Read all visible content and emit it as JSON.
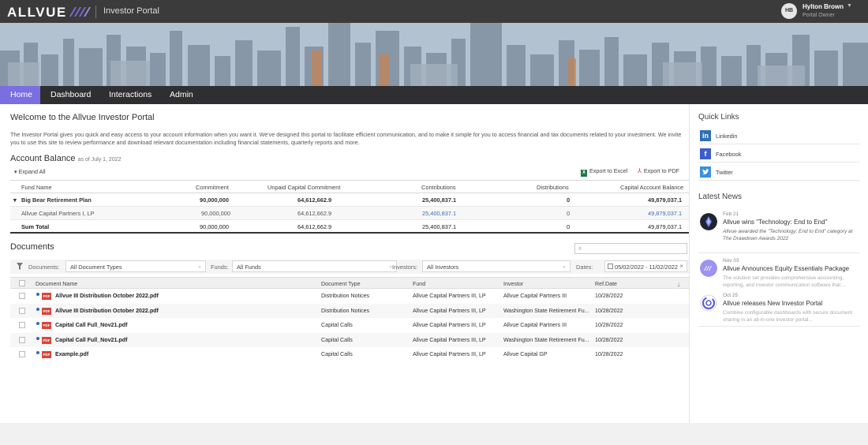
{
  "header": {
    "logo_text": "ALLVUE",
    "portal_title": "Investor Portal",
    "user": {
      "initials": "HB",
      "name": "Hylton Brown",
      "role": "Portal Owner"
    }
  },
  "nav": {
    "items": [
      {
        "label": "Home",
        "active": true
      },
      {
        "label": "Dashboard",
        "active": false
      },
      {
        "label": "Interactions",
        "active": false
      },
      {
        "label": "Admin",
        "active": false
      }
    ]
  },
  "welcome": {
    "title": "Welcome to the Allvue Investor Portal",
    "intro": "The Investor Portal gives you quick and easy access to your account information when you want it. We've designed this portal to facilitate efficient communication, and to make it simple for you to access financial and tax documents related to your investment. We invite you to use this site to review performance and download relevant documentation including financial statements, quarterly reports and more."
  },
  "account_balance": {
    "title": "Account Balance",
    "as_of": "as of July 1, 2022",
    "expand_all": "Expand All",
    "export_excel": "Export to Excel",
    "export_pdf": "Export to PDF",
    "columns": [
      "Fund Name",
      "Commitment",
      "Unpaid Capital Commitment",
      "Contributions",
      "Distributions",
      "Capital Account Balance"
    ],
    "rows": [
      {
        "fund": "Big Bear Retirement Plan",
        "commitment": "90,000,000",
        "unpaid": "64,612,662.9",
        "contributions": "25,400,837.1",
        "distributions": "0",
        "balance": "49,879,037.1"
      },
      {
        "fund": "Allvue Capital Partners I, LP",
        "commitment": "90,000,000",
        "unpaid": "64,612,662.9",
        "contributions": "25,400,837.1",
        "distributions": "0",
        "balance": "49,879,037.1"
      },
      {
        "fund": "Sum Total",
        "commitment": "90,000,000",
        "unpaid": "64,612,662.9",
        "contributions": "25,400,837.1",
        "distributions": "0",
        "balance": "49,879,037.1"
      }
    ]
  },
  "documents": {
    "title": "Documents",
    "filters": {
      "documents_label": "Documents:",
      "documents_value": "All Document Types",
      "funds_label": "Funds:",
      "funds_value": "All Funds",
      "investors_label": "Investors:",
      "investors_value": "All Investors",
      "dates_label": "Dates:",
      "dates_value": "05/02/2022 - 11/02/2022"
    },
    "columns": [
      "Document Name",
      "Document Type",
      "Fund",
      "Investor",
      "Ref.Date"
    ],
    "rows": [
      {
        "name": "Allvue III Distribution October 2022.pdf",
        "type": "Distribution Notices",
        "fund": "Allvue Capital Partners III, LP",
        "investor": "Allvue Capital Partners III",
        "date": "10/28/2022"
      },
      {
        "name": "Allvue III Distribution October 2022.pdf",
        "type": "Distribution Notices",
        "fund": "Allvue Capital Partners III, LP",
        "investor": "Washington State Retirement Fu...",
        "date": "10/28/2022"
      },
      {
        "name": "Capital Call Full_Nov21.pdf",
        "type": "Capital Calls",
        "fund": "Allvue Capital Partners III, LP",
        "investor": "Allvue Capital Partners III",
        "date": "10/28/2022"
      },
      {
        "name": "Capital Call Full_Nov21.pdf",
        "type": "Capital Calls",
        "fund": "Allvue Capital Partners III, LP",
        "investor": "Washington State Retirement Fu...",
        "date": "10/28/2022"
      },
      {
        "name": "Example.pdf",
        "type": "Capital Calls",
        "fund": "Allvue Capital Partners III, LP",
        "investor": "Allvue Capital GP",
        "date": "10/28/2022"
      }
    ]
  },
  "quick_links": {
    "title": "Quick Links",
    "items": [
      {
        "label": "Linkedin",
        "icon": "linkedin-icon",
        "glyph": "in",
        "color": "#2f6fb5"
      },
      {
        "label": "Facebook",
        "icon": "facebook-icon",
        "glyph": "f",
        "color": "#3b5ec9"
      },
      {
        "label": "Twitter",
        "icon": "twitter-icon",
        "glyph": "t",
        "color": "#3b8fe0"
      }
    ]
  },
  "news": {
    "title": "Latest News",
    "items": [
      {
        "date": "Feb 21",
        "title": "Allvue wins \"Technology: End to End\"",
        "body": "Allvue awarded the \"Technology: End to End\" category at The Drawdown Awards 2022"
      },
      {
        "date": "Nov 03",
        "title": "Allvue Announces Equity Essentials Package",
        "body": "The solution set provides comprehensive accounting, reporting, and investor communication software that ..."
      },
      {
        "date": "Oct 25",
        "title": "Allvue releases New Investor Portal",
        "body": "Combine configurable dashboards with secure document sharing in an all-in-one investor portal..."
      }
    ]
  },
  "colors": {
    "accent": "#7a6ee0",
    "nav_bg": "#2f2f31",
    "topbar_bg": "#3b3b3b",
    "link": "#3c6fb6",
    "pdf_red": "#d9463a"
  }
}
